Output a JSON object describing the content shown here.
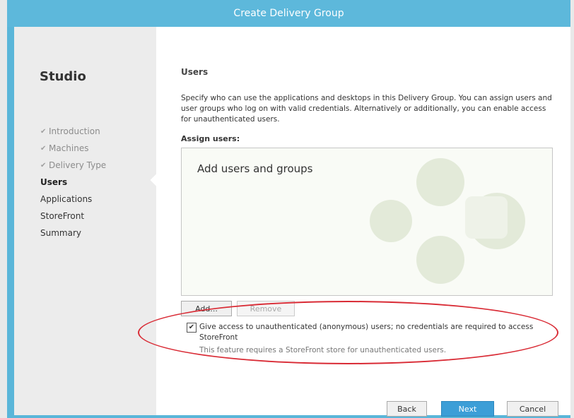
{
  "window": {
    "title": "Create Delivery Group"
  },
  "sidebar": {
    "app_title": "Studio",
    "steps": [
      {
        "label": "Introduction",
        "state": "done"
      },
      {
        "label": "Machines",
        "state": "done"
      },
      {
        "label": "Delivery Type",
        "state": "done"
      },
      {
        "label": "Users",
        "state": "active"
      },
      {
        "label": "Applications",
        "state": "pending"
      },
      {
        "label": "StoreFront",
        "state": "pending"
      },
      {
        "label": "Summary",
        "state": "pending"
      }
    ]
  },
  "main": {
    "title": "Users",
    "description": "Specify who can use the applications and desktops in this Delivery Group. You can assign users and user groups who log on with valid credentials. Alternatively or additionally, you can enable access for unauthenticated users.",
    "assign_label": "Assign users:",
    "userbox_placeholder": "Add users and groups",
    "add_button": "Add...",
    "remove_button": "Remove",
    "anonymous_checkbox": {
      "checked": true,
      "label": "Give access to unauthenticated (anonymous) users; no credentials are required to access StoreFront",
      "note": "This feature requires a StoreFront store for unauthenticated users."
    }
  },
  "footer": {
    "back": "Back",
    "next": "Next",
    "cancel": "Cancel"
  },
  "colors": {
    "titlebar": "#5db8db",
    "primary_button": "#3c9ed7",
    "annotation": "#d92b35"
  }
}
